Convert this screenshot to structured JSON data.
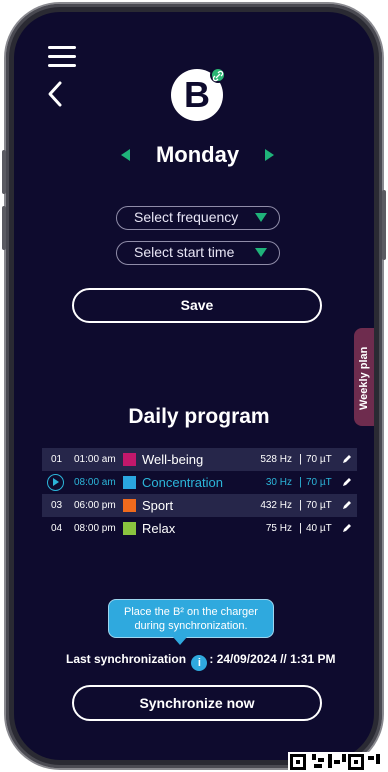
{
  "header": {
    "logo_letter": "B",
    "day": "Monday"
  },
  "selects": {
    "frequency": "Select frequency",
    "start_time": "Select start time"
  },
  "save_label": "Save",
  "weekly_tab": "Weekly plan",
  "program": {
    "title": "Daily program",
    "rows": [
      {
        "num": "01",
        "time": "01:00 am",
        "name": "Well-being",
        "color": "#c2186b",
        "freq": "528 Hz",
        "field": "70 µT",
        "active": false
      },
      {
        "num": "",
        "time": "08:00 am",
        "name": "Concentration",
        "color": "#2aa6e0",
        "freq": "30 Hz",
        "field": "70 µT",
        "active": true
      },
      {
        "num": "03",
        "time": "06:00 pm",
        "name": "Sport",
        "color": "#f06a1d",
        "freq": "432 Hz",
        "field": "70 µT",
        "active": false
      },
      {
        "num": "04",
        "time": "08:00 pm",
        "name": "Relax",
        "color": "#8ac43f",
        "freq": "75 Hz",
        "field": "40 µT",
        "active": false
      }
    ]
  },
  "tooltip": {
    "line1": "Place the B² on the charger",
    "line2": "during synchronization."
  },
  "sync": {
    "label": "Last synchronization",
    "info_glyph": "i",
    "value": ": 24/09/2024 // 1:31 PM",
    "button": "Synchronize now"
  },
  "colors": {
    "background": "#0e0b2e",
    "accent_green": "#1fb37a",
    "accent_blue": "#2cb5d9",
    "weekly_tab": "#6e2c4e"
  }
}
